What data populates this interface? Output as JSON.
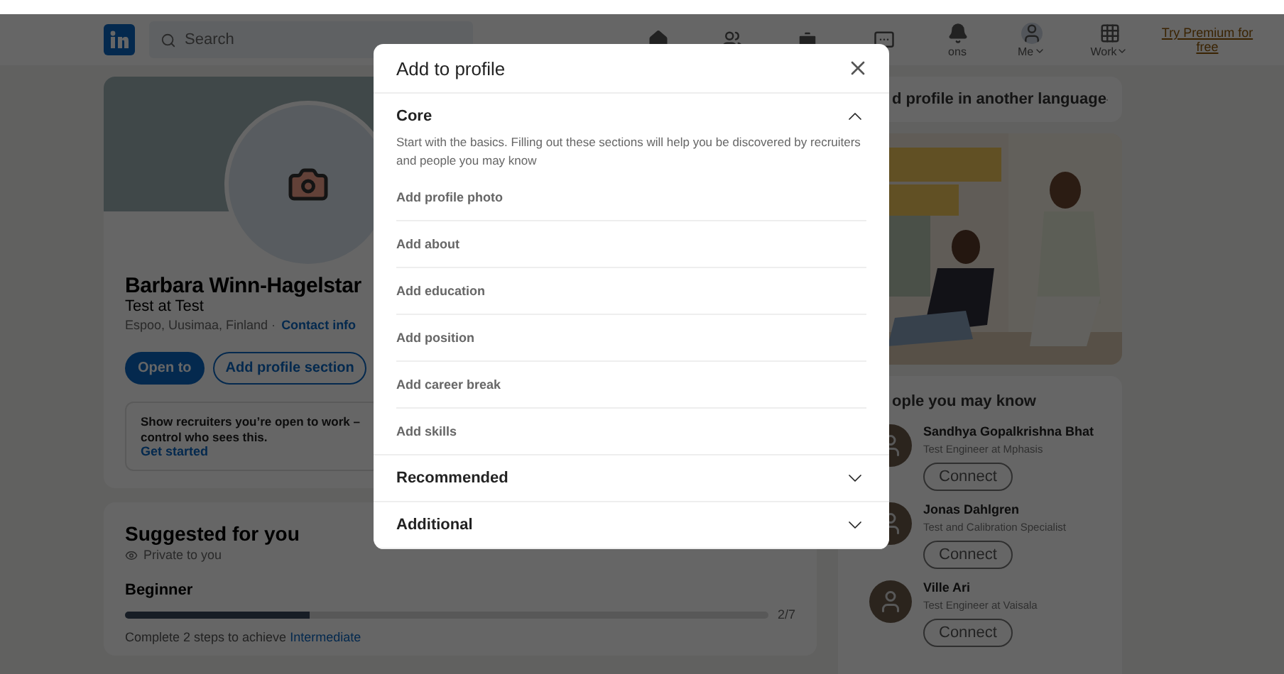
{
  "nav": {
    "search_placeholder": "Search",
    "items": [
      {
        "kind": "home"
      },
      {
        "kind": "network"
      },
      {
        "kind": "jobs"
      },
      {
        "kind": "messaging"
      },
      {
        "kind": "notifications",
        "label": "ons"
      },
      {
        "kind": "me",
        "label": "Me"
      },
      {
        "kind": "work",
        "label": "Work"
      }
    ],
    "premium": "Try Premium for free"
  },
  "profile": {
    "name": "Barbara Winn-Hagelstar",
    "headline": "Test at Test",
    "location": "Espoo, Uusimaa, Finland ·",
    "contact": "Contact info",
    "buttons": [
      {
        "label": "Open to",
        "kind": "primary"
      },
      {
        "label": "Add profile section",
        "kind": "outline"
      }
    ],
    "open_to_work": {
      "text": "Show recruiters you’re open to work – control who sees this.",
      "link": "Get started"
    }
  },
  "suggested": {
    "title": "Suggested for you",
    "privacy": "Private to you",
    "level_name": "Beginner",
    "level": 0.2857,
    "count": "2/7",
    "hint": "Complete 2 steps to achieve",
    "hint_link": "Intermediate"
  },
  "sidebar": {
    "language": "d profile in another language",
    "people_title": "ople you may know",
    "people": [
      {
        "name": "Sandhya Gopalkrishna Bhat",
        "title": "Test Engineer at Mphasis",
        "action": "Connect"
      },
      {
        "name": "Jonas Dahlgren",
        "title": "Test and Calibration Specialist",
        "action": "Connect"
      },
      {
        "name": "Ville Ari",
        "title": "Test Engineer at Vaisala",
        "action": "Connect"
      }
    ]
  },
  "modal": {
    "title": "Add to profile",
    "sections": [
      {
        "title": "Core",
        "expanded": true,
        "description": "Start with the basics. Filling out these sections will help you be discovered by recruiters and people you may know",
        "items": [
          "Add profile photo",
          "Add about",
          "Add education",
          "Add position",
          "Add career break",
          "Add skills"
        ]
      },
      {
        "title": "Recommended",
        "expanded": false
      },
      {
        "title": "Additional",
        "expanded": false
      }
    ]
  }
}
